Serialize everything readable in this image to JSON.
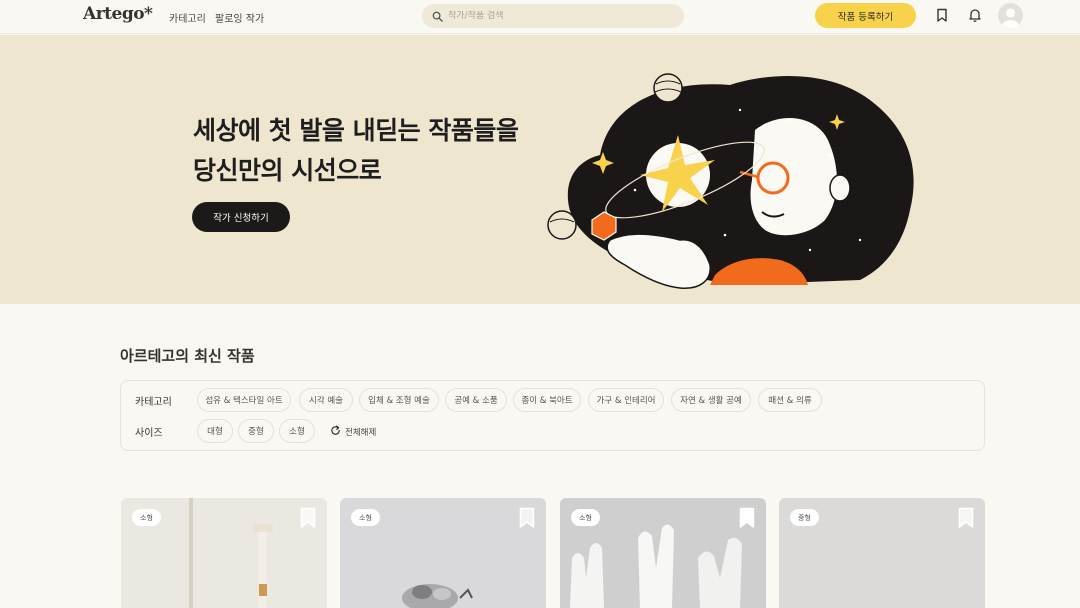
{
  "header": {
    "logo": "Artego*",
    "nav": [
      "카테고리",
      "팔로잉 작가"
    ],
    "search_placeholder": "작가/작품 검색",
    "register_label": "작품 등록하기"
  },
  "hero": {
    "title_line1": "세상에 첫 발을 내딛는 작품들을",
    "title_line2": "당신만의 시선으로",
    "button_label": "작가 신청하기"
  },
  "section": {
    "title": "아르테고의 최신 작품"
  },
  "filters": {
    "category_label": "카테고리",
    "categories": [
      "섬유 & 텍스타일 아트",
      "시각 예술",
      "입체 & 조형 예술",
      "공예 & 소품",
      "종이 & 북아트",
      "가구 & 인테리어",
      "자연 & 생활 공예",
      "패션 & 의류"
    ],
    "size_label": "사이즈",
    "sizes": [
      "대형",
      "중형",
      "소형"
    ],
    "reset_label": "전체해제"
  },
  "cards": [
    {
      "badge": "소형",
      "bg": "#ebe8e2"
    },
    {
      "badge": "소형",
      "bg": "#d9d8da"
    },
    {
      "badge": "소형",
      "bg": "#cfcfcf"
    },
    {
      "badge": "중형",
      "bg": "#dcdad8"
    }
  ],
  "colors": {
    "accent": "#f7d24a",
    "hero_bg": "#efe6cf",
    "page_bg": "#faf8f3",
    "dark": "#1c1a19"
  },
  "icons": [
    "search-icon",
    "bookmark-icon",
    "bell-icon",
    "user-avatar-icon",
    "refresh-icon"
  ]
}
